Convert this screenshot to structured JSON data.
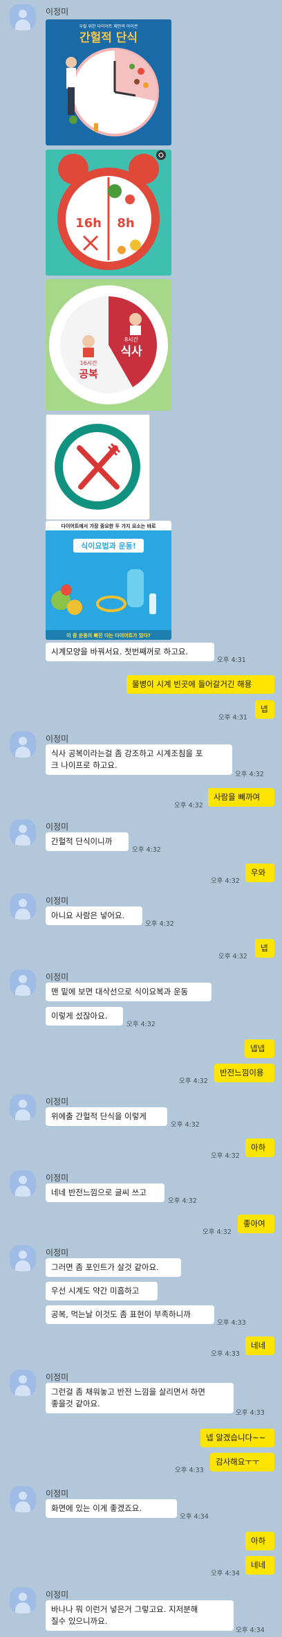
{
  "sender": "이정미",
  "images": {
    "img1": {
      "subtitle": "우릴 위한 다이어트 제안의 아이콘",
      "title": "간헐적 단식"
    },
    "img3": {
      "left_small": "16시간",
      "left_big": "공복",
      "right_small": "8시간",
      "right_big": "식사"
    },
    "img2": {
      "left_label": "16h",
      "right_label": "8h"
    },
    "img5": {
      "top_text": "다이어트에서 가장 중요한 두 가지 요소는 바로",
      "mid_text": "식이요법과 운동!",
      "bottom_text": "이 중 운동이 빠진 다는 다이어트가 있다?"
    }
  },
  "messages": {
    "m1": {
      "text": "시계모양을 바꿔서요. 첫번째꺼로 하고요.",
      "time": "오후 4:31"
    },
    "m2": {
      "text": "물병이 시계 빈곳에 들어갈거긴 해용",
      "time": "오후 4:31"
    },
    "m3": {
      "text": "넵"
    },
    "m4": {
      "text": "식사 공복이라는걸 좀 강조하고 시계조침을 포\n크 나이프로 하고요.",
      "time": "오후 4:32"
    },
    "m5": {
      "text": "사람을 빼까여",
      "time": "오후 4:32"
    },
    "m6": {
      "text": "간헐적 단식이니까",
      "time": "오후 4:32"
    },
    "m7": {
      "text": "우와",
      "time": "오후 4:32"
    },
    "m8": {
      "text": "아니요 사람은 넣어요.",
      "time": "오후 4:32"
    },
    "m9": {
      "text": "넵",
      "time": "오후 4:32"
    },
    "m10": {
      "text": "맨 밑에 보면 대삭선으로 식이요복과 운동"
    },
    "m11": {
      "text": "이렇게 섰잖아요.",
      "time": "오후 4:32"
    },
    "m12": {
      "text": "넵넵"
    },
    "m13": {
      "text": "반전느낌이용",
      "time": "오후 4:32"
    },
    "m14": {
      "text": "위에출 간헐적 단식을 이렇게",
      "time": "오후 4:32"
    },
    "m15": {
      "text": "아하",
      "time": "오후 4:32"
    },
    "m16": {
      "text": "네네 반전느낌으로 글씨 쓰고",
      "time": "오후 4:32"
    },
    "m17": {
      "text": "좋아여",
      "time": "오후 4:32"
    },
    "m18": {
      "text": "그러면 좀 포인트가 살것 같아요."
    },
    "m19": {
      "text": "우선 시계도 약간 미흡하고"
    },
    "m20": {
      "text": "공복, 먹는날 이것도 좀 표현이 부족하니까",
      "time": "오후 4:33"
    },
    "m21": {
      "text": "네네",
      "time": "오후 4:33"
    },
    "m22": {
      "text": "그런걸 좀 채워놓고 반전 느낌을 살리면서 하면\n좋을것 같아요.",
      "time": "오후 4:33"
    },
    "m23": {
      "text": "넵 알겠습니다~~"
    },
    "m24": {
      "text": "감사해요ㅜㅜ",
      "time": "오후 4:33"
    },
    "m25": {
      "text": "화면에 있는 이게 좋겠죠요.",
      "time": "오후 4:34"
    },
    "m26": {
      "text": "아하"
    },
    "m27": {
      "text": "네네",
      "time": "오후 4:34"
    },
    "m28": {
      "text": "바나나 뭐 이런거 넣은거 그렇고요. 지저분해\n질수 있으니까요.",
      "time": "오후 4:34"
    }
  },
  "colors": {
    "background": "#b2c7d9",
    "incoming": "#ffffff",
    "outgoing": "#fee500"
  }
}
